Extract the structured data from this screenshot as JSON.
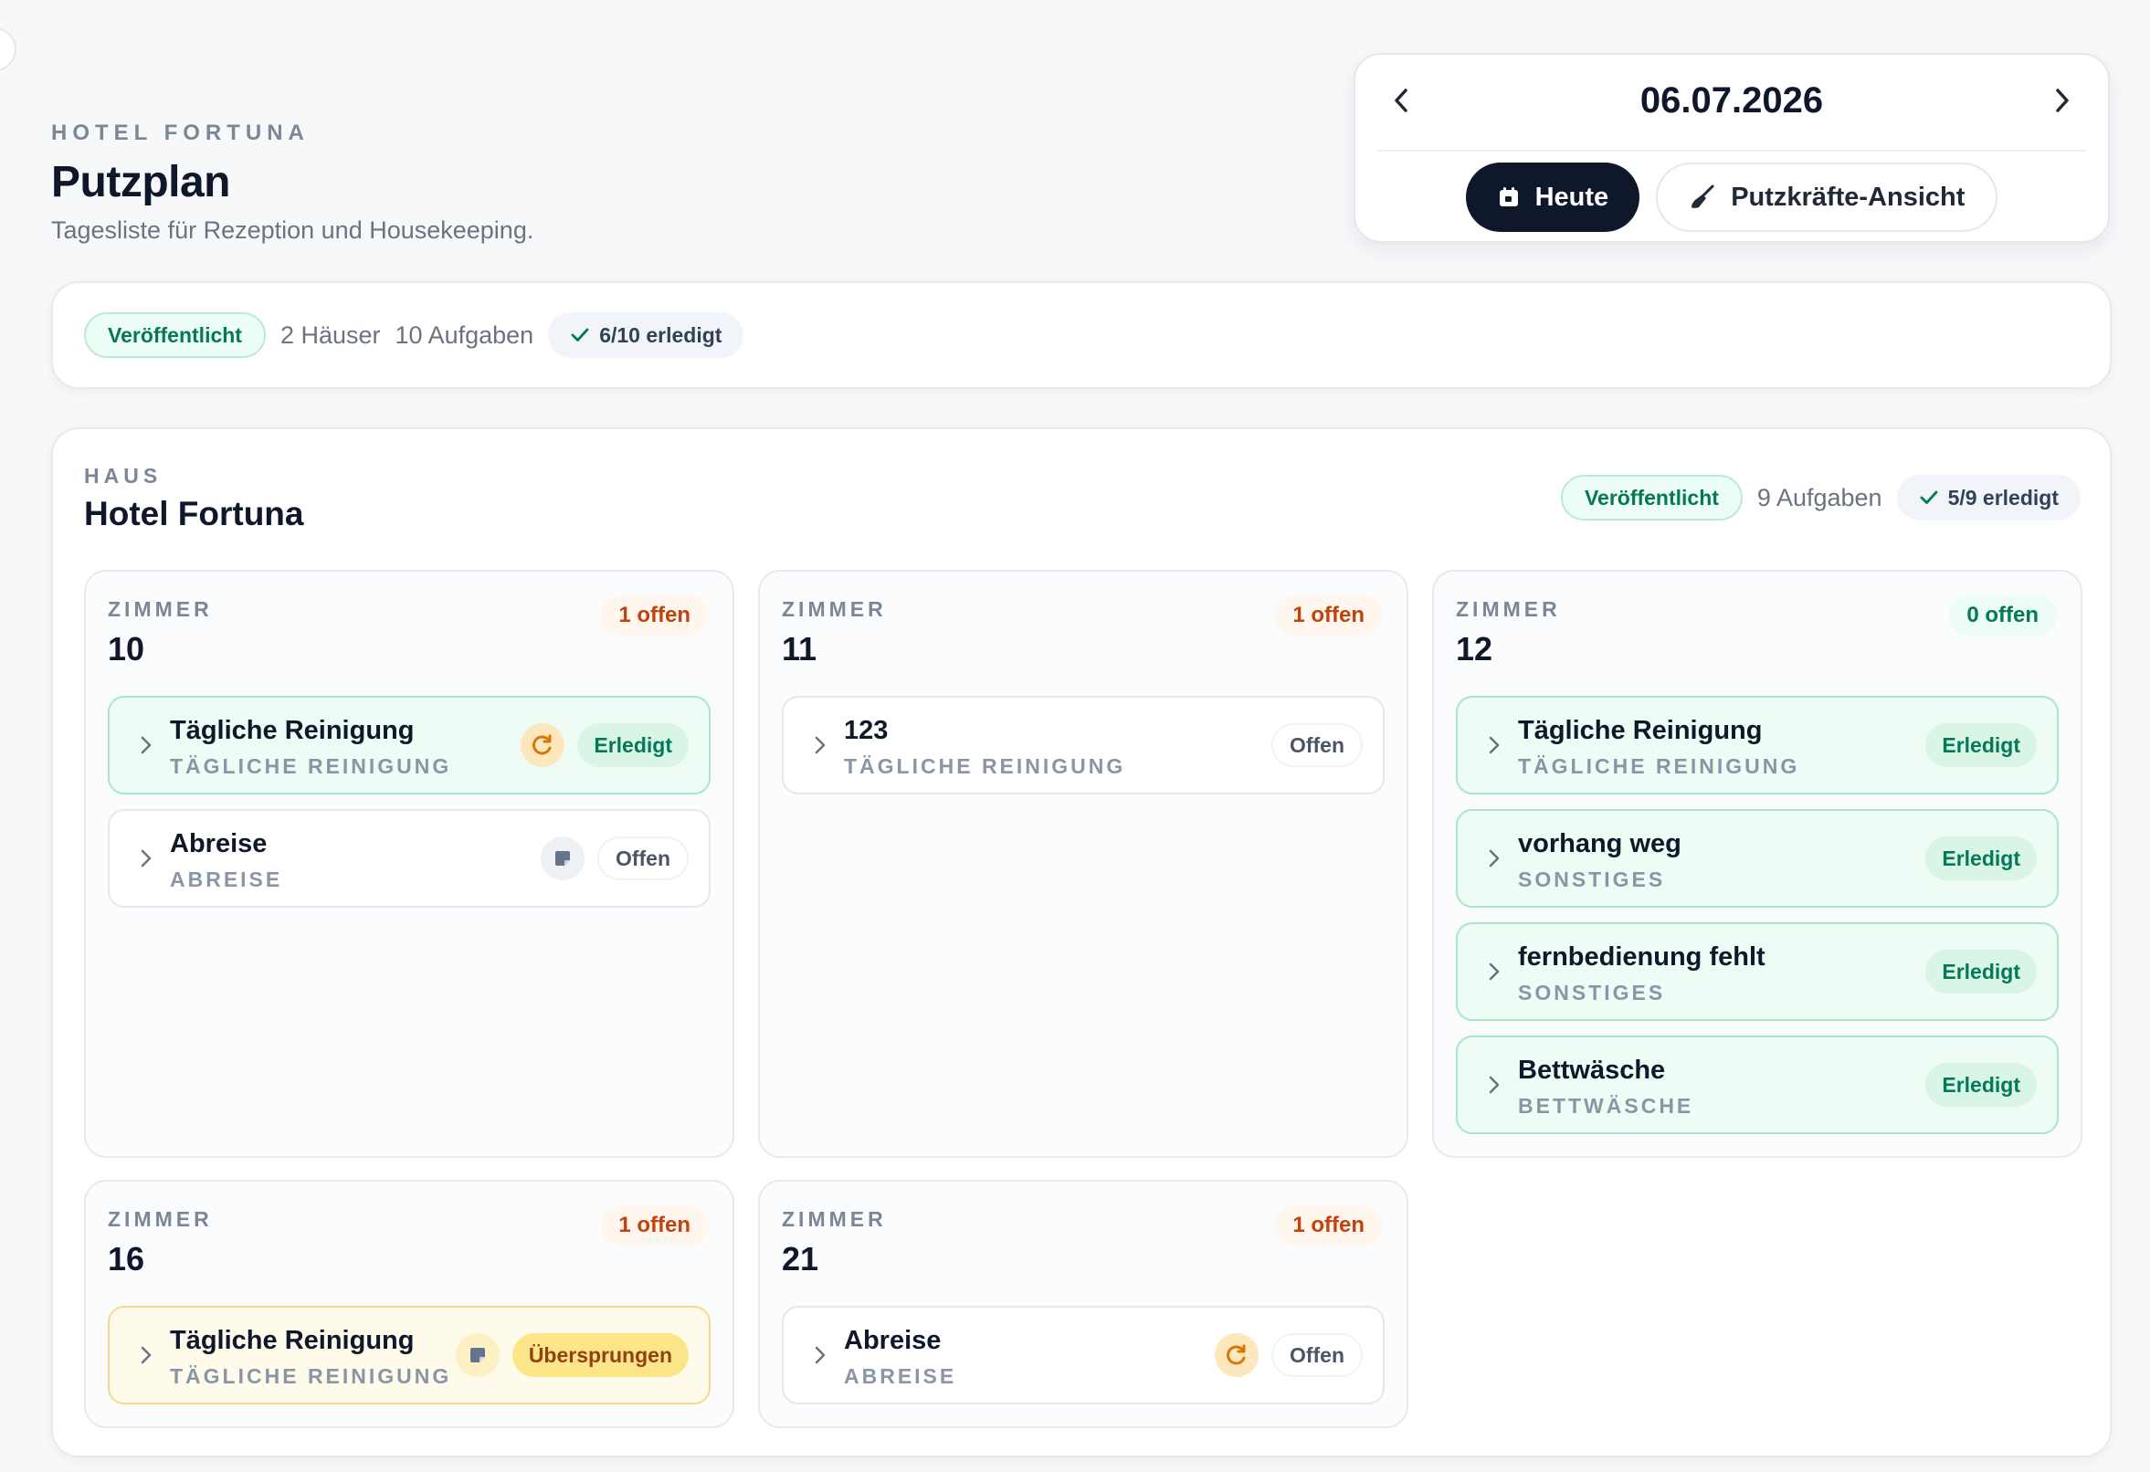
{
  "header": {
    "eyebrow": "HOTEL FORTUNA",
    "title": "Putzplan",
    "subtitle": "Tagesliste für Rezeption und Housekeeping."
  },
  "date_nav": {
    "date": "06.07.2026",
    "today_label": "Heute",
    "cleaner_view_label": "Putzkräfte-Ansicht"
  },
  "summary": {
    "status": "Veröffentlicht",
    "houses": "2 Häuser",
    "tasks": "10 Aufgaben",
    "done": "6/10 erledigt"
  },
  "house": {
    "eyebrow": "HAUS",
    "name": "Hotel Fortuna",
    "status": "Veröffentlicht",
    "tasks": "9 Aufgaben",
    "done": "5/9 erledigt",
    "room_eyebrow": "ZIMMER"
  },
  "rooms": [
    {
      "number": "10",
      "open": "1 offen",
      "tasks": [
        {
          "title": "Tägliche Reinigung",
          "sub": "TÄGLICHE REINIGUNG",
          "status": "Erledigt"
        },
        {
          "title": "Abreise",
          "sub": "ABREISE",
          "status": "Offen"
        }
      ]
    },
    {
      "number": "11",
      "open": "1 offen",
      "tasks": [
        {
          "title": "123",
          "sub": "TÄGLICHE REINIGUNG",
          "status": "Offen"
        }
      ]
    },
    {
      "number": "12",
      "open": "0 offen",
      "tasks": [
        {
          "title": "Tägliche Reinigung",
          "sub": "TÄGLICHE REINIGUNG",
          "status": "Erledigt"
        },
        {
          "title": "vorhang weg",
          "sub": "SONSTIGES",
          "status": "Erledigt"
        },
        {
          "title": "fernbedienung fehlt",
          "sub": "SONSTIGES",
          "status": "Erledigt"
        },
        {
          "title": "Bettwäsche",
          "sub": "BETTWÄSCHE",
          "status": "Erledigt"
        }
      ]
    },
    {
      "number": "16",
      "open": "1 offen",
      "tasks": [
        {
          "title": "Tägliche Reinigung",
          "sub": "TÄGLICHE REINIGUNG",
          "status": "Übersprungen"
        }
      ]
    },
    {
      "number": "21",
      "open": "1 offen",
      "tasks": [
        {
          "title": "Abreise",
          "sub": "ABREISE",
          "status": "Offen"
        }
      ]
    }
  ],
  "colors": {
    "accent_dark": "#0f172a",
    "done_green": "#047857",
    "open_orange": "#c2410c",
    "skipped_amber": "#92400e"
  },
  "icons": [
    "chevron-left-icon",
    "chevron-right-icon",
    "calendar-icon",
    "broom-icon",
    "check-icon",
    "refresh-icon",
    "note-icon",
    "chevron-right-small-icon"
  ]
}
